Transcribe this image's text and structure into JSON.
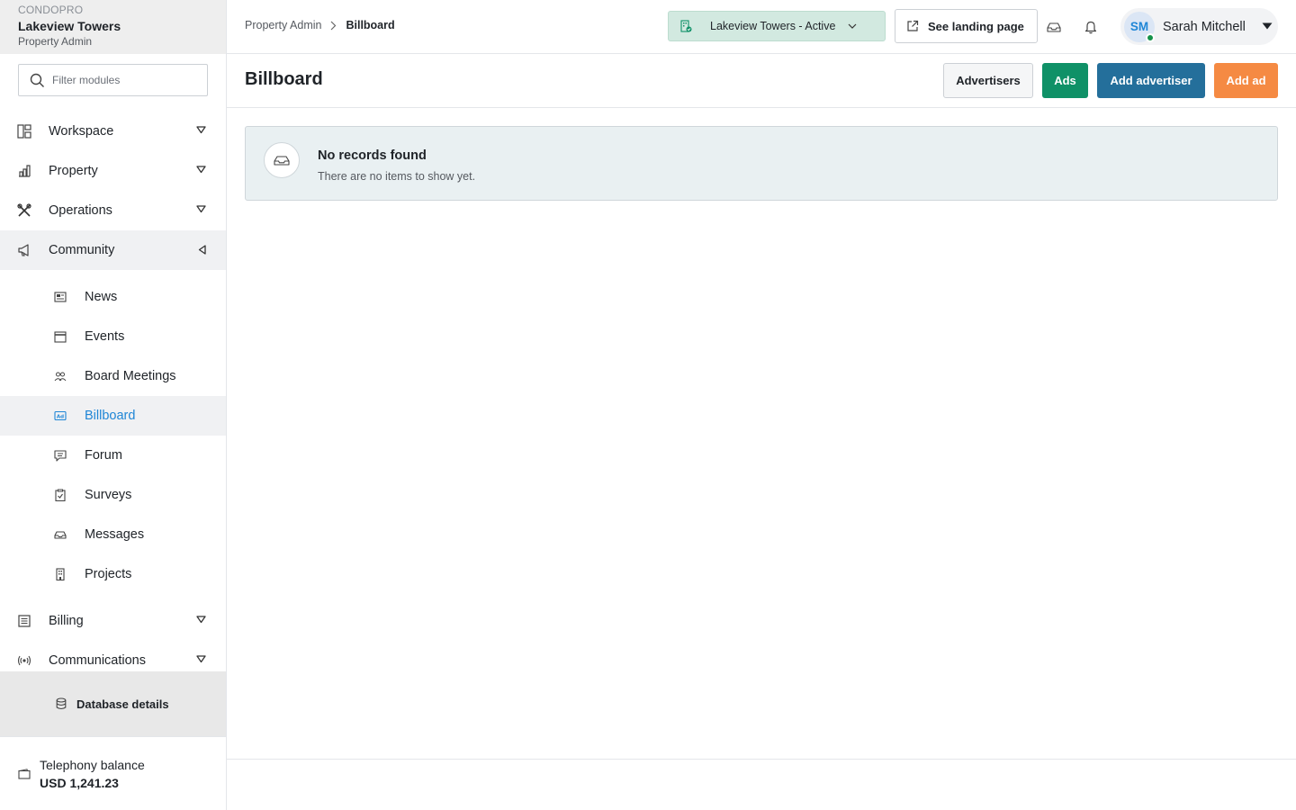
{
  "brand": {
    "app_name": "CONDOPRO",
    "property_name": "Lakeview Towers",
    "role": "Property Admin"
  },
  "sidebar": {
    "filter_placeholder": "Filter modules",
    "items": [
      {
        "label": "Workspace",
        "icon": "grid-icon",
        "state": "collapsed"
      },
      {
        "label": "Property",
        "icon": "building-chart-icon",
        "state": "collapsed"
      },
      {
        "label": "Operations",
        "icon": "tools-icon",
        "state": "collapsed"
      },
      {
        "label": "Community",
        "icon": "megaphone-icon",
        "state": "expanded"
      }
    ],
    "community_sub": [
      {
        "label": "News",
        "icon": "newspaper-icon"
      },
      {
        "label": "Events",
        "icon": "calendar-icon"
      },
      {
        "label": "Board Meetings",
        "icon": "people-icon"
      },
      {
        "label": "Billboard",
        "icon": "ad-icon",
        "active": true
      },
      {
        "label": "Forum",
        "icon": "chat-icon"
      },
      {
        "label": "Surveys",
        "icon": "clipboard-icon"
      },
      {
        "label": "Messages",
        "icon": "inbox-icon"
      },
      {
        "label": "Projects",
        "icon": "office-building-icon"
      }
    ],
    "items_after": [
      {
        "label": "Billing",
        "icon": "ledger-icon",
        "state": "collapsed"
      },
      {
        "label": "Communications",
        "icon": "broadcast-icon",
        "state": "collapsed"
      }
    ],
    "database_details": "Database details",
    "telephony": {
      "label": "Telephony balance",
      "value": "USD 1,241.23"
    }
  },
  "topbar": {
    "breadcrumb": [
      "Property Admin",
      "Billboard"
    ],
    "property_select": "Lakeview Towers - Active",
    "landing_button": "See landing page",
    "user": {
      "initials": "SM",
      "name": "Sarah Mitchell",
      "status_color": "#15934a"
    }
  },
  "page": {
    "title": "Billboard",
    "buttons": {
      "advertisers": "Advertisers",
      "ads": "Ads",
      "add_advertiser": "Add advertiser",
      "add_ad": "Add ad"
    },
    "empty": {
      "title": "No records found",
      "description": "There are no items to show yet."
    }
  },
  "colors": {
    "accent_blue": "#1f86d6",
    "green": "#0f9167",
    "blue": "#246f9b",
    "orange": "#f58a43"
  }
}
